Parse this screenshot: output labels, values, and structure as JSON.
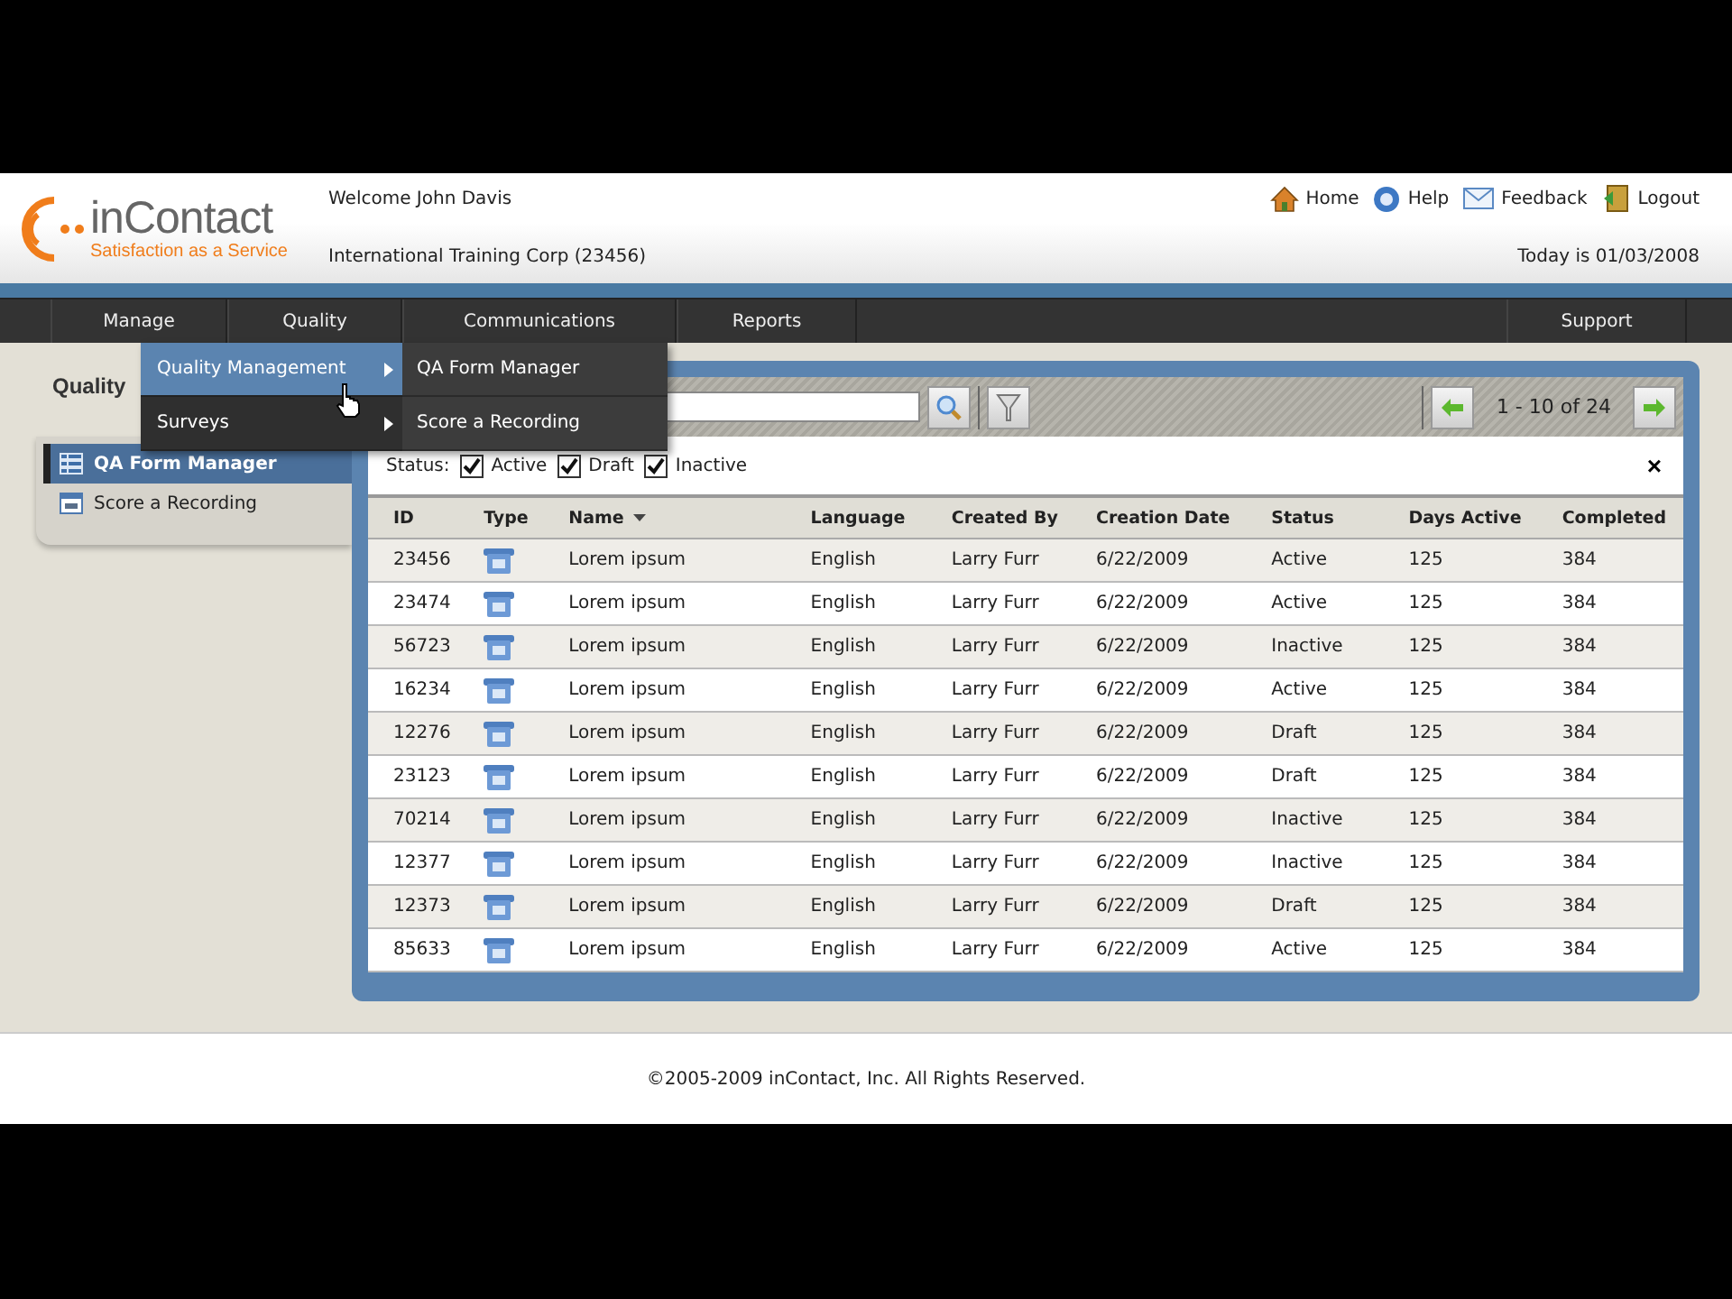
{
  "header": {
    "logo": {
      "name": "inContact",
      "tagline": "Satisfaction as a Service"
    },
    "welcome": "Welcome John Davis",
    "company": "International Training Corp (23456)",
    "links": [
      {
        "label": "Home",
        "kind": "home"
      },
      {
        "label": "Help",
        "kind": "help"
      },
      {
        "label": "Feedback",
        "kind": "mail"
      },
      {
        "label": "Logout",
        "kind": "logout"
      }
    ],
    "date": "Today is 01/03/2008"
  },
  "nav": {
    "items": [
      {
        "label": "Manage"
      },
      {
        "label": "Quality"
      },
      {
        "label": "Communications"
      },
      {
        "label": "Reports"
      }
    ],
    "right_items": [
      {
        "label": "Support"
      }
    ]
  },
  "menu": {
    "items": [
      {
        "label": "Quality Management",
        "selected": true
      },
      {
        "label": "Surveys",
        "selected": false
      }
    ],
    "submenu": [
      {
        "label": "QA Form Manager"
      },
      {
        "label": "Score a Recording"
      }
    ]
  },
  "page_title": "Quality",
  "sidebar": {
    "items": [
      {
        "label": "QA Form Manager",
        "selected": true,
        "kind": "list"
      },
      {
        "label": "Score a Recording",
        "selected": false,
        "kind": "calendar"
      }
    ]
  },
  "toolbar": {
    "pagination": "1 - 10 of 24"
  },
  "filters": {
    "label": "Status:",
    "options": [
      {
        "label": "Active",
        "checked": true
      },
      {
        "label": "Draft",
        "checked": true
      },
      {
        "label": "Inactive",
        "checked": true
      }
    ],
    "close": "×"
  },
  "table": {
    "columns": [
      {
        "label": "ID",
        "sorted": false
      },
      {
        "label": "Type",
        "sorted": false
      },
      {
        "label": "Name",
        "sorted": true
      },
      {
        "label": "Language",
        "sorted": false
      },
      {
        "label": "Created By",
        "sorted": false
      },
      {
        "label": "Creation Date",
        "sorted": false
      },
      {
        "label": "Status",
        "sorted": false
      },
      {
        "label": "Days Active",
        "sorted": false
      },
      {
        "label": "Completed",
        "sorted": false
      }
    ],
    "rows": [
      {
        "id": "23456",
        "name": "Lorem ipsum",
        "language": "English",
        "created_by": "Larry Furr",
        "creation_date": "6/22/2009",
        "status": "Active",
        "days_active": "125",
        "completed": "384"
      },
      {
        "id": "23474",
        "name": "Lorem ipsum",
        "language": "English",
        "created_by": "Larry Furr",
        "creation_date": "6/22/2009",
        "status": "Active",
        "days_active": "125",
        "completed": "384"
      },
      {
        "id": "56723",
        "name": "Lorem ipsum",
        "language": "English",
        "created_by": "Larry Furr",
        "creation_date": "6/22/2009",
        "status": "Inactive",
        "days_active": "125",
        "completed": "384"
      },
      {
        "id": "16234",
        "name": "Lorem ipsum",
        "language": "English",
        "created_by": "Larry Furr",
        "creation_date": "6/22/2009",
        "status": "Active",
        "days_active": "125",
        "completed": "384"
      },
      {
        "id": "12276",
        "name": "Lorem ipsum",
        "language": "English",
        "created_by": "Larry Furr",
        "creation_date": "6/22/2009",
        "status": "Draft",
        "days_active": "125",
        "completed": "384"
      },
      {
        "id": "23123",
        "name": "Lorem ipsum",
        "language": "English",
        "created_by": "Larry Furr",
        "creation_date": "6/22/2009",
        "status": "Draft",
        "days_active": "125",
        "completed": "384"
      },
      {
        "id": "70214",
        "name": "Lorem ipsum",
        "language": "English",
        "created_by": "Larry Furr",
        "creation_date": "6/22/2009",
        "status": "Inactive",
        "days_active": "125",
        "completed": "384"
      },
      {
        "id": "12377",
        "name": "Lorem ipsum",
        "language": "English",
        "created_by": "Larry Furr",
        "creation_date": "6/22/2009",
        "status": "Inactive",
        "days_active": "125",
        "completed": "384"
      },
      {
        "id": "12373",
        "name": "Lorem ipsum",
        "language": "English",
        "created_by": "Larry Furr",
        "creation_date": "6/22/2009",
        "status": "Draft",
        "days_active": "125",
        "completed": "384"
      },
      {
        "id": "85633",
        "name": "Lorem ipsum",
        "language": "English",
        "created_by": "Larry Furr",
        "creation_date": "6/22/2009",
        "status": "Active",
        "days_active": "125",
        "completed": "384"
      }
    ]
  },
  "footer": "©2005-2009 inContact, Inc. All Rights Reserved."
}
